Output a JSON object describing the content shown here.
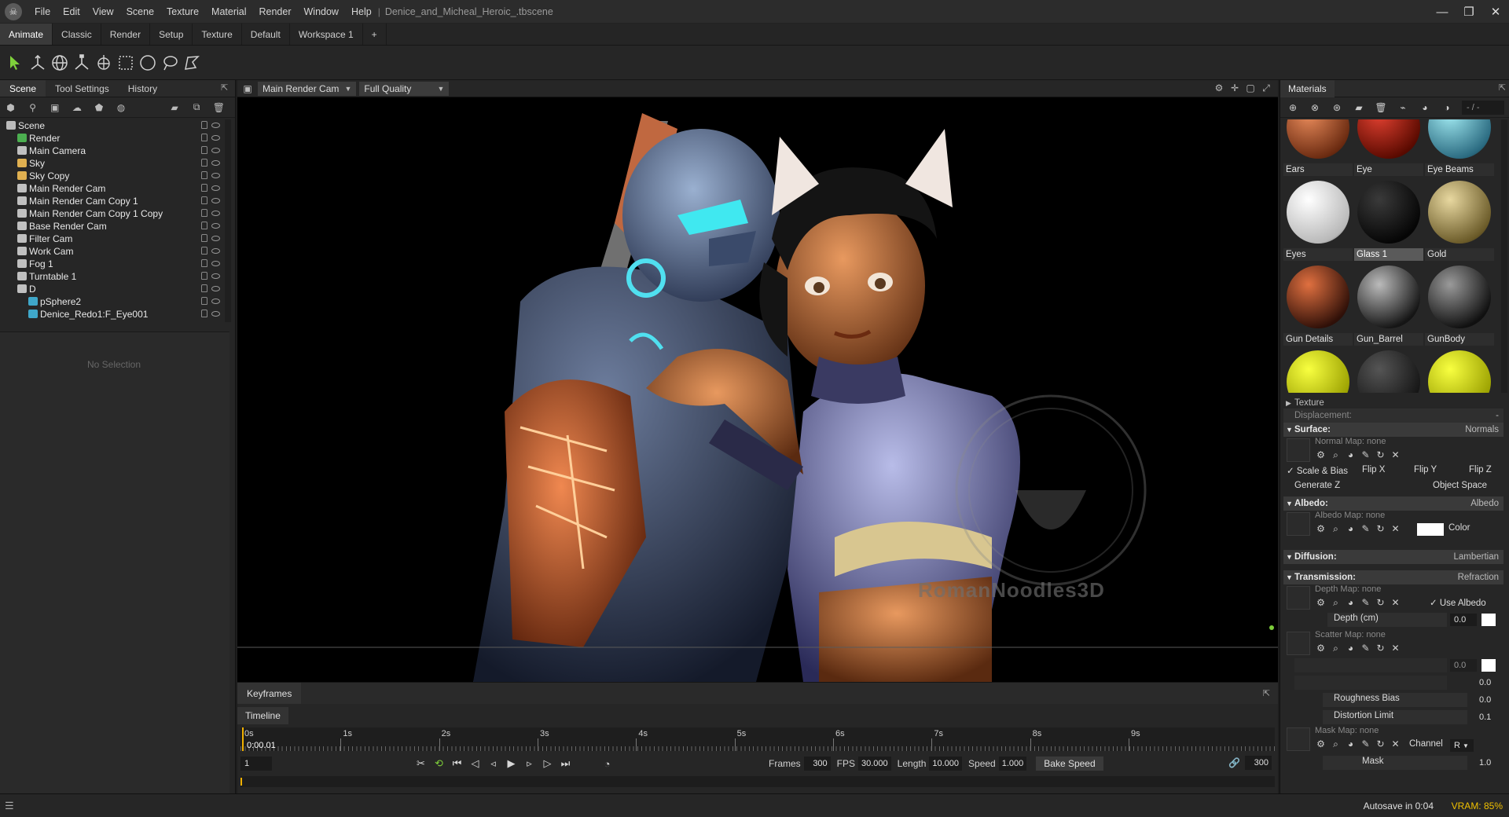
{
  "app": {
    "menu": [
      "File",
      "Edit",
      "View",
      "Scene",
      "Texture",
      "Material",
      "Render",
      "Window",
      "Help"
    ],
    "separator": "|",
    "document_title": "Denice_and_Micheal_Heroic_.tbscene"
  },
  "workspace_tabs": [
    "Animate",
    "Classic",
    "Render",
    "Setup",
    "Texture",
    "Default",
    "Workspace 1",
    "+"
  ],
  "left_panel": {
    "tabs": [
      "Scene",
      "Tool Settings",
      "History"
    ],
    "tree": [
      {
        "label": "Scene",
        "icon": "scene-icon",
        "color": "#bbbbbb",
        "indent": 0
      },
      {
        "label": "Render",
        "icon": "render-icon",
        "color": "#4caf50",
        "indent": 1
      },
      {
        "label": "Main Camera",
        "icon": "camera-icon",
        "color": "#c0c0c0",
        "indent": 1
      },
      {
        "label": "Sky",
        "icon": "sky-icon",
        "color": "#e0b050",
        "indent": 1
      },
      {
        "label": "Sky Copy",
        "icon": "sky-icon",
        "color": "#e0b050",
        "indent": 1
      },
      {
        "label": "Main Render Cam",
        "icon": "camera-icon",
        "color": "#c0c0c0",
        "indent": 1
      },
      {
        "label": "Main Render Cam  Copy 1",
        "icon": "camera-icon",
        "color": "#c0c0c0",
        "indent": 1
      },
      {
        "label": "Main Render Cam  Copy 1 Copy",
        "icon": "camera-icon",
        "color": "#c0c0c0",
        "indent": 1
      },
      {
        "label": "Base Render Cam",
        "icon": "camera-icon",
        "color": "#c0c0c0",
        "indent": 1
      },
      {
        "label": "Filter Cam",
        "icon": "camera-icon",
        "color": "#c0c0c0",
        "indent": 1
      },
      {
        "label": "Work Cam",
        "icon": "camera-icon",
        "color": "#c0c0c0",
        "indent": 1
      },
      {
        "label": "Fog 1",
        "icon": "fog-icon",
        "color": "#c0c0c0",
        "indent": 1
      },
      {
        "label": "Turntable 1",
        "icon": "turntable-icon",
        "color": "#c0c0c0",
        "indent": 1
      },
      {
        "label": "D",
        "icon": "group-icon",
        "color": "#c0c0c0",
        "indent": 1
      },
      {
        "label": "pSphere2",
        "icon": "mesh-icon",
        "color": "#3fa7c9",
        "indent": 2
      },
      {
        "label": "Denice_Redo1:F_Eye001",
        "icon": "mesh-icon",
        "color": "#3fa7c9",
        "indent": 2
      }
    ],
    "no_selection": "No Selection"
  },
  "viewport": {
    "camera": "Main Render Cam",
    "quality": "Full Quality",
    "watermark": "RomanNoodles3D"
  },
  "timeline": {
    "keyframes_tab": "Keyframes",
    "timeline_tab": "Timeline",
    "ticks": [
      "0s",
      "1s",
      "2s",
      "3s",
      "4s",
      "5s",
      "6s",
      "7s",
      "8s",
      "9s"
    ],
    "current_time": "0:00.01",
    "current_frame": "1",
    "frames_label": "Frames",
    "frames": "300",
    "fps_label": "FPS",
    "fps": "30.000",
    "length_label": "Length",
    "length": "10.000",
    "speed_label": "Speed",
    "speed": "1.000",
    "bake_label": "Bake Speed",
    "end_frame": "300",
    "playhead_fraction": 0.0
  },
  "materials": {
    "title": "Materials",
    "search": "- / -",
    "items": [
      {
        "label": "Ears",
        "c1": "#e88a5a",
        "c2": "#6a2a10"
      },
      {
        "label": "Eye",
        "c1": "#e04030",
        "c2": "#5a0a00"
      },
      {
        "label": "Eye Beams",
        "c1": "#9fe8f0",
        "c2": "#2a6a80"
      },
      {
        "label": "Eyes",
        "c1": "#ffffff",
        "c2": "#b8b8b8"
      },
      {
        "label": "Glass 1",
        "c1": "#3a3a3a",
        "c2": "#050505"
      },
      {
        "label": "Gold",
        "c1": "#e8d8a0",
        "c2": "#6a5a28"
      },
      {
        "label": "Gun Details",
        "c1": "#e07040",
        "c2": "#301008"
      },
      {
        "label": "Gun_Barrel",
        "c1": "#bbbbbb",
        "c2": "#151515"
      },
      {
        "label": "GunBody",
        "c1": "#9a9a9a",
        "c2": "#101010"
      },
      {
        "label": "",
        "c1": "#f8ff40",
        "c2": "#9aa000"
      },
      {
        "label": "",
        "c1": "#555555",
        "c2": "#151515"
      },
      {
        "label": "",
        "c1": "#f8ff40",
        "c2": "#9aa000"
      }
    ],
    "selected_index": 4
  },
  "properties": {
    "texture": "Texture",
    "displacement": "Displacement:",
    "displacement_value": "-",
    "surface": "Surface:",
    "surface_value": "Normals",
    "normal_map": "Normal Map: none",
    "scale_bias": "Scale & Bias",
    "flip_x": "Flip X",
    "flip_y": "Flip Y",
    "flip_z": "Flip Z",
    "generate_z": "Generate Z",
    "object_space": "Object Space",
    "albedo": "Albedo:",
    "albedo_value": "Albedo",
    "albedo_map": "Albedo Map: none",
    "color_label": "Color",
    "diffusion": "Diffusion:",
    "diffusion_value": "Lambertian",
    "transmission": "Transmission:",
    "transmission_value": "Refraction",
    "depth_map": "Depth Map: none",
    "use_albedo": "Use Albedo",
    "depth_label": "Depth (cm)",
    "depth_value": "0.0",
    "scatter_map": "Scatter Map: none",
    "scatter_value": "0.0",
    "anisotropy_value": "0.0",
    "roughness_bias": "Roughness Bias",
    "roughness_value": "0.0",
    "distortion_limit": "Distortion Limit",
    "distortion_value": "0.1",
    "mask_map": "Mask Map: none",
    "channel": "Channel",
    "channel_value": "R",
    "mask": "Mask",
    "mask_value": "1.0"
  },
  "status": {
    "autosave": "Autosave in 0:04",
    "vram": "VRAM: 85%"
  }
}
